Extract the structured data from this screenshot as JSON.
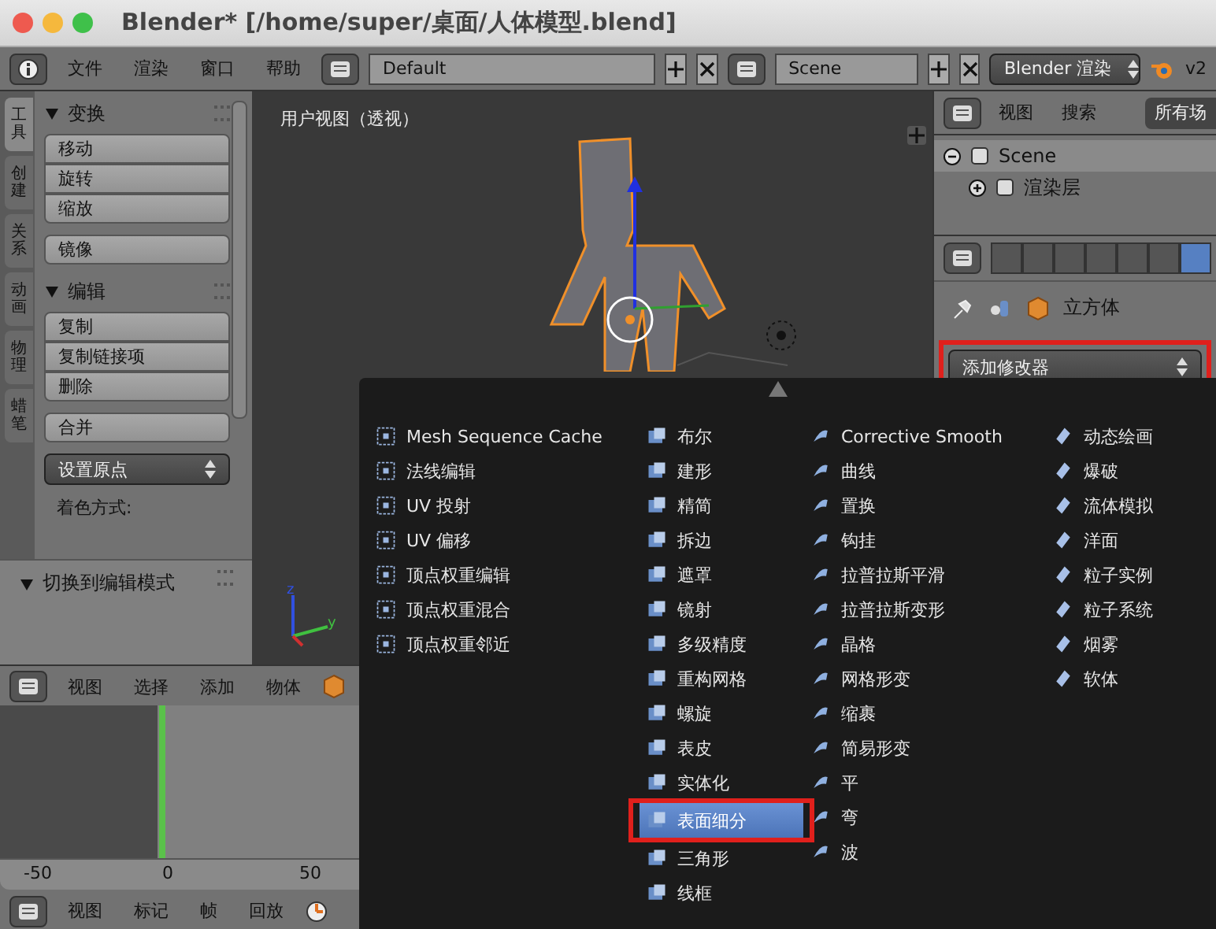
{
  "window": {
    "title": "Blender* [/home/super/桌面/人体模型.blend]"
  },
  "top_header": {
    "menus": [
      "文件",
      "渲染",
      "窗口",
      "帮助"
    ],
    "layout": "Default",
    "scene": "Scene",
    "engine": "Blender 渲染",
    "version": "v2"
  },
  "tool_tabs": [
    {
      "label": "工具",
      "selected": true
    },
    {
      "label": "创建",
      "selected": false
    },
    {
      "label": "关系",
      "selected": false
    },
    {
      "label": "动画",
      "selected": false
    },
    {
      "label": "物理",
      "selected": false
    },
    {
      "label": "蜡笔",
      "selected": false
    }
  ],
  "tool_panels": [
    {
      "title": "变换",
      "expanded": true,
      "items": [
        {
          "kind": "buttons",
          "labels": [
            "移动",
            "旋转",
            "缩放"
          ]
        },
        {
          "kind": "buttons",
          "labels": [
            "镜像"
          ]
        }
      ]
    },
    {
      "title": "编辑",
      "expanded": true,
      "items": [
        {
          "kind": "buttons",
          "labels": [
            "复制",
            "复制链接项",
            "删除"
          ]
        },
        {
          "kind": "buttons",
          "labels": [
            "合并"
          ]
        },
        {
          "kind": "dropdown",
          "labels": [
            "设置原点"
          ]
        },
        {
          "kind": "label",
          "labels": [
            "着色方式:"
          ]
        }
      ]
    }
  ],
  "operator_panel": {
    "title": "切换到编辑模式",
    "expanded": true
  },
  "viewport": {
    "label": "用户视图（透视）",
    "axis_labels": [
      "z",
      "y"
    ]
  },
  "view3d_header": {
    "menus": [
      "视图",
      "选择",
      "添加",
      "物体"
    ]
  },
  "timeline": {
    "ticks": [
      "-50",
      "0",
      "50"
    ]
  },
  "timeline_header": {
    "menus": [
      "视图",
      "标记",
      "帧",
      "回放"
    ]
  },
  "outliner": {
    "menus": [
      "视图",
      "搜索"
    ],
    "filter": "所有场",
    "tree": [
      {
        "label": "Scene",
        "expanded": true,
        "children": [
          {
            "label": "渲染层",
            "expanded": false
          }
        ]
      }
    ]
  },
  "properties": {
    "tabs": [
      {
        "selected": false
      },
      {
        "selected": false
      },
      {
        "selected": false
      },
      {
        "selected": false
      },
      {
        "selected": false
      },
      {
        "selected": false
      },
      {
        "selected": true
      }
    ],
    "breadcrumb": "立方体",
    "add_modifier": {
      "label": "添加修改器",
      "annotated": true
    }
  },
  "modifier_menu": {
    "columns": [
      [
        {
          "label": "Mesh Sequence Cache",
          "selected": false,
          "annotated": false
        },
        {
          "label": "法线编辑",
          "selected": false,
          "annotated": false
        },
        {
          "label": "UV 投射",
          "selected": false,
          "annotated": false
        },
        {
          "label": "UV 偏移",
          "selected": false,
          "annotated": false
        },
        {
          "label": "顶点权重编辑",
          "selected": false,
          "annotated": false
        },
        {
          "label": "顶点权重混合",
          "selected": false,
          "annotated": false
        },
        {
          "label": "顶点权重邻近",
          "selected": false,
          "annotated": false
        }
      ],
      [
        {
          "label": "布尔",
          "selected": false,
          "annotated": false
        },
        {
          "label": "建形",
          "selected": false,
          "annotated": false
        },
        {
          "label": "精简",
          "selected": false,
          "annotated": false
        },
        {
          "label": "拆边",
          "selected": false,
          "annotated": false
        },
        {
          "label": "遮罩",
          "selected": false,
          "annotated": false
        },
        {
          "label": "镜射",
          "selected": false,
          "annotated": false
        },
        {
          "label": "多级精度",
          "selected": false,
          "annotated": false
        },
        {
          "label": "重构网格",
          "selected": false,
          "annotated": false
        },
        {
          "label": "螺旋",
          "selected": false,
          "annotated": false
        },
        {
          "label": "表皮",
          "selected": false,
          "annotated": false
        },
        {
          "label": "实体化",
          "selected": false,
          "annotated": false
        },
        {
          "label": "表面细分",
          "selected": true,
          "annotated": true
        },
        {
          "label": "三角形",
          "selected": false,
          "annotated": false
        },
        {
          "label": "线框",
          "selected": false,
          "annotated": false
        }
      ],
      [
        {
          "label": "Corrective Smooth",
          "selected": false,
          "annotated": false
        },
        {
          "label": "曲线",
          "selected": false,
          "annotated": false
        },
        {
          "label": "置换",
          "selected": false,
          "annotated": false
        },
        {
          "label": "钩挂",
          "selected": false,
          "annotated": false
        },
        {
          "label": "拉普拉斯平滑",
          "selected": false,
          "annotated": false
        },
        {
          "label": "拉普拉斯变形",
          "selected": false,
          "annotated": false
        },
        {
          "label": "晶格",
          "selected": false,
          "annotated": false
        },
        {
          "label": "网格形变",
          "selected": false,
          "annotated": false
        },
        {
          "label": "缩裹",
          "selected": false,
          "annotated": false
        },
        {
          "label": "简易形变",
          "selected": false,
          "annotated": false
        },
        {
          "label": "平",
          "selected": false,
          "annotated": false
        },
        {
          "label": "弯",
          "selected": false,
          "annotated": false
        },
        {
          "label": "波",
          "selected": false,
          "annotated": false
        }
      ],
      [
        {
          "label": "动态绘画",
          "selected": false,
          "annotated": false
        },
        {
          "label": "爆破",
          "selected": false,
          "annotated": false
        },
        {
          "label": "流体模拟",
          "selected": false,
          "annotated": false
        },
        {
          "label": "洋面",
          "selected": false,
          "annotated": false
        },
        {
          "label": "粒子实例",
          "selected": false,
          "annotated": false
        },
        {
          "label": "粒子系统",
          "selected": false,
          "annotated": false
        },
        {
          "label": "烟雾",
          "selected": false,
          "annotated": false
        },
        {
          "label": "软体",
          "selected": false,
          "annotated": false
        }
      ]
    ]
  }
}
